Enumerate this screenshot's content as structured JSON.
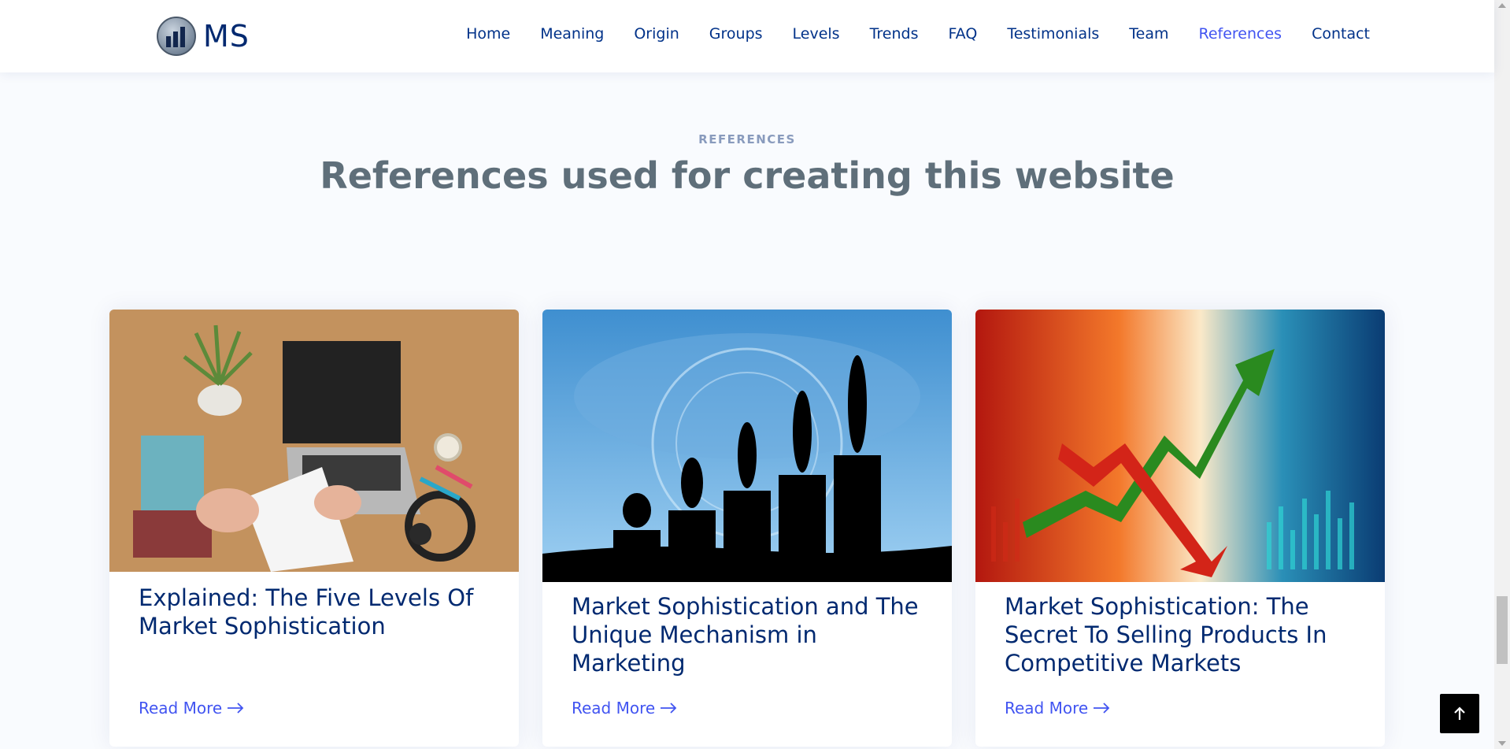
{
  "header": {
    "logo_text": "MS",
    "nav": [
      {
        "label": "Home",
        "active": false
      },
      {
        "label": "Meaning",
        "active": false
      },
      {
        "label": "Origin",
        "active": false
      },
      {
        "label": "Groups",
        "active": false
      },
      {
        "label": "Levels",
        "active": false
      },
      {
        "label": "Trends",
        "active": false
      },
      {
        "label": "FAQ",
        "active": false
      },
      {
        "label": "Testimonials",
        "active": false
      },
      {
        "label": "Team",
        "active": false
      },
      {
        "label": "References",
        "active": true
      },
      {
        "label": "Contact",
        "active": false
      }
    ]
  },
  "section": {
    "eyebrow": "REFERENCES",
    "title": "References used for creating this website"
  },
  "cards": [
    {
      "title": "Explained: The Five Levels Of Market Sophistication",
      "read_more": "Read More",
      "image": "desk-laptop-marketing-book"
    },
    {
      "title": "Market Sophistication and The Unique Mechanism in Marketing",
      "read_more": "Read More",
      "image": "human-evolution-silhouettes"
    },
    {
      "title": "Market Sophistication: The Secret To Selling Products In Competitive Markets",
      "read_more": "Read More",
      "image": "stock-market-arrows"
    }
  ],
  "colors": {
    "brand": "#012970",
    "accent": "#4154f1",
    "title_gray": "#5f6f7a"
  },
  "icons": {
    "back_to_top": "arrow-up-icon",
    "read_more": "arrow-right-icon"
  }
}
